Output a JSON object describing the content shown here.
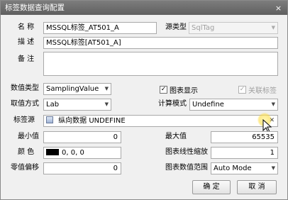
{
  "window": {
    "title": "标签数据查询配置",
    "close_icon": "×"
  },
  "form": {
    "name_label": "名 称",
    "name_value": "MSSQL标签_AT501_A",
    "source_type_label": "源类型",
    "source_type_value": "SqlTag",
    "desc_label": "描 述",
    "desc_value": "MSSQL标签[AT501_A]",
    "note_label": "备 注",
    "note_value": "",
    "value_type_label": "数值类型",
    "value_type_value": "SamplingValue",
    "show_chart_label": "图表显示",
    "show_chart_checked": "✓",
    "link_tag_label": "关联标签",
    "link_tag_checked": "✓",
    "fetch_mode_label": "取值方式",
    "fetch_mode_value": "Lab",
    "calc_mode_label": "计算模式",
    "calc_mode_value": "Undefine",
    "tag_source_label": "标签源",
    "tag_source_value": "纵向数据 UNDEFINE",
    "tag_source_clear": "✕",
    "min_label": "最小值",
    "min_value": "0",
    "max_label": "最大值",
    "max_value": "65535",
    "color_label": "颜 色",
    "color_value": "0, 0, 0",
    "color_swatch": "#000000",
    "chart_scale_label": "图表线性缩放",
    "chart_scale_value": "1",
    "zero_offset_label": "零值偏移",
    "zero_offset_value": "0",
    "chart_range_label": "图表数值范围",
    "chart_range_value": "Auto Mode"
  },
  "buttons": {
    "ok": "确 定",
    "cancel": "取 消"
  }
}
